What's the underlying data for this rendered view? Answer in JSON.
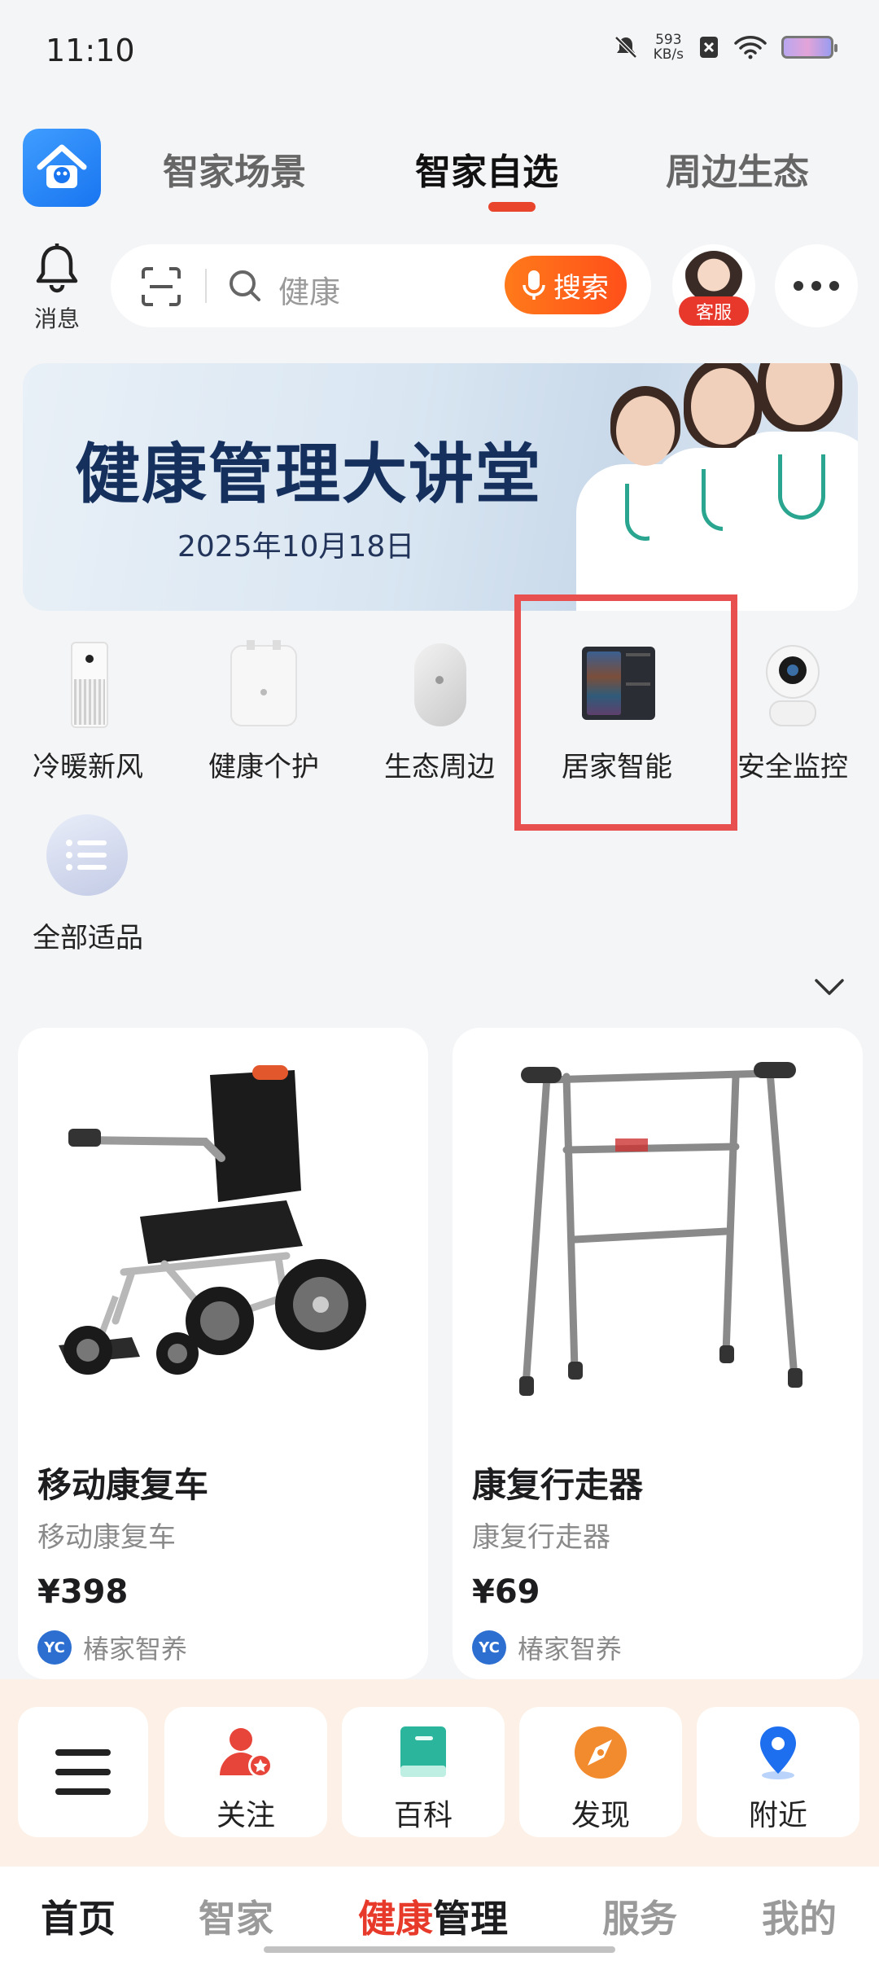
{
  "status_bar": {
    "time": "11:10",
    "net_speed_value": "593",
    "net_speed_unit": "KB/s"
  },
  "top_tabs": [
    {
      "label": "智家场景",
      "active": false
    },
    {
      "label": "智家自选",
      "active": true
    },
    {
      "label": "周边生态",
      "active": false
    }
  ],
  "header": {
    "bell_label": "消息",
    "search_placeholder": "健康",
    "search_button": "搜索",
    "service_label": "客服"
  },
  "banner": {
    "title": "健康管理大讲堂",
    "date": "2025年10月18日"
  },
  "categories": [
    {
      "label": "冷暖新风",
      "icon": "air-purifier-icon"
    },
    {
      "label": "健康个护",
      "icon": "personal-care-device-icon"
    },
    {
      "label": "生态周边",
      "icon": "smart-sensor-icon"
    },
    {
      "label": "居家智能",
      "icon": "smart-panel-icon",
      "highlighted": true
    },
    {
      "label": "安全监控",
      "icon": "security-camera-icon"
    },
    {
      "label": "全部适品",
      "icon": "list-icon"
    }
  ],
  "products": [
    {
      "title": "移动康复车",
      "subtitle": "移动康复车",
      "price": "¥398",
      "shop": "椿家智养",
      "shop_logo": "YC",
      "image": "wheelchair"
    },
    {
      "title": "康复行走器",
      "subtitle": "康复行走器",
      "price": "¥69",
      "shop": "椿家智养",
      "shop_logo": "YC",
      "image": "walker"
    }
  ],
  "dock": [
    {
      "label": "",
      "icon": "menu-icon"
    },
    {
      "label": "关注",
      "icon": "user-star-icon"
    },
    {
      "label": "百科",
      "icon": "book-icon"
    },
    {
      "label": "发现",
      "icon": "compass-icon"
    },
    {
      "label": "附近",
      "icon": "location-pin-icon"
    }
  ],
  "bottom_nav": {
    "home": "首页",
    "smart_home": "智家",
    "health_part1": "健康",
    "health_part2": "管理",
    "service": "服务",
    "mine": "我的"
  },
  "colors": {
    "accent": "#e8452c",
    "search_button": "#ff5a1a",
    "highlight_box": "#e85050",
    "dock_bg": "#fdf0e6"
  }
}
